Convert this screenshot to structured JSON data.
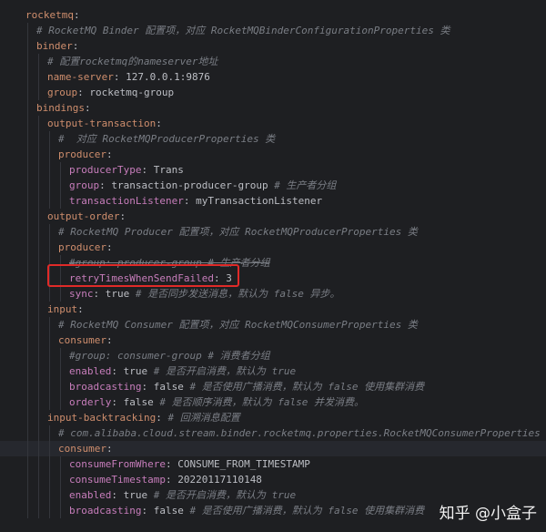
{
  "editor": {
    "highlight_line": 17,
    "current_line": 28,
    "lines": [
      {
        "indent": 0,
        "key": "rocketmq",
        "key_type": "root",
        "sep": ":",
        "value": "",
        "comment": ""
      },
      {
        "indent": 1,
        "key": "",
        "sep": "",
        "value": "",
        "comment": "# RocketMQ Binder 配置项，对应 RocketMQBinderConfigurationProperties 类"
      },
      {
        "indent": 1,
        "key": "binder",
        "key_type": "root",
        "sep": ":",
        "value": "",
        "comment": ""
      },
      {
        "indent": 2,
        "key": "",
        "sep": "",
        "value": "",
        "comment": "# 配置rocketmq的nameserver地址"
      },
      {
        "indent": 2,
        "key": "name-server",
        "key_type": "root",
        "sep": ": ",
        "value": "127.0.0.1:9876",
        "comment": ""
      },
      {
        "indent": 2,
        "key": "group",
        "key_type": "root",
        "sep": ": ",
        "value": "rocketmq-group",
        "comment": ""
      },
      {
        "indent": 1,
        "key": "bindings",
        "key_type": "root",
        "sep": ":",
        "value": "",
        "comment": ""
      },
      {
        "indent": 2,
        "key": "output-transaction",
        "key_type": "root",
        "sep": ":",
        "value": "",
        "comment": ""
      },
      {
        "indent": 3,
        "key": "",
        "sep": "",
        "value": "",
        "comment": "#  对应 RocketMQProducerProperties 类"
      },
      {
        "indent": 3,
        "key": "producer",
        "key_type": "root",
        "sep": ":",
        "value": "",
        "comment": ""
      },
      {
        "indent": 4,
        "key": "producerType",
        "key_type": "prop",
        "sep": ": ",
        "value": "Trans",
        "comment": ""
      },
      {
        "indent": 4,
        "key": "group",
        "key_type": "prop",
        "sep": ": ",
        "value": "transaction-producer-group ",
        "comment": "# 生产者分组"
      },
      {
        "indent": 4,
        "key": "transactionListener",
        "key_type": "prop",
        "sep": ": ",
        "value": "myTransactionListener",
        "comment": ""
      },
      {
        "indent": 2,
        "key": "output-order",
        "key_type": "root",
        "sep": ":",
        "value": "",
        "comment": ""
      },
      {
        "indent": 3,
        "key": "",
        "sep": "",
        "value": "",
        "comment": "# RocketMQ Producer 配置项，对应 RocketMQProducerProperties 类"
      },
      {
        "indent": 3,
        "key": "producer",
        "key_type": "root",
        "sep": ":",
        "value": "",
        "comment": ""
      },
      {
        "indent": 4,
        "key": "",
        "sep": "",
        "value": "",
        "comment": "#group: producer-group # 生产者分组",
        "strike": true
      },
      {
        "indent": 4,
        "key": "retryTimesWhenSendFailed",
        "key_type": "prop",
        "sep": ": ",
        "value": "3",
        "comment": ""
      },
      {
        "indent": 4,
        "key": "sync",
        "key_type": "prop",
        "sep": ": ",
        "value": "true ",
        "comment": "# 是否同步发送消息，默认为 false 异步。"
      },
      {
        "indent": 2,
        "key": "input",
        "key_type": "root",
        "sep": ":",
        "value": "",
        "comment": ""
      },
      {
        "indent": 3,
        "key": "",
        "sep": "",
        "value": "",
        "comment": "# RocketMQ Consumer 配置项，对应 RocketMQConsumerProperties 类"
      },
      {
        "indent": 3,
        "key": "consumer",
        "key_type": "root",
        "sep": ":",
        "value": "",
        "comment": ""
      },
      {
        "indent": 4,
        "key": "",
        "sep": "",
        "value": "",
        "comment": "#group: consumer-group # 消费者分组"
      },
      {
        "indent": 4,
        "key": "enabled",
        "key_type": "prop",
        "sep": ": ",
        "value": "true ",
        "comment": "# 是否开启消费，默认为 true"
      },
      {
        "indent": 4,
        "key": "broadcasting",
        "key_type": "prop",
        "sep": ": ",
        "value": "false ",
        "comment": "# 是否使用广播消费，默认为 false 使用集群消费"
      },
      {
        "indent": 4,
        "key": "orderly",
        "key_type": "prop",
        "sep": ": ",
        "value": "false ",
        "comment": "# 是否顺序消费，默认为 false 并发消费。"
      },
      {
        "indent": 2,
        "key": "input-backtracking",
        "key_type": "root",
        "sep": ":",
        "value": " ",
        "comment": "# 回溯消息配置"
      },
      {
        "indent": 3,
        "key": "",
        "sep": "",
        "value": "",
        "comment": "# com.alibaba.cloud.stream.binder.rocketmq.properties.RocketMQConsumerProperties"
      },
      {
        "indent": 3,
        "key": "consumer",
        "key_type": "root",
        "sep": ":",
        "value": "",
        "comment": ""
      },
      {
        "indent": 4,
        "key": "consumeFromWhere",
        "key_type": "prop",
        "sep": ": ",
        "value": "CONSUME_FROM_TIMESTAMP",
        "comment": ""
      },
      {
        "indent": 4,
        "key": "consumeTimestamp",
        "key_type": "prop",
        "sep": ": ",
        "value": "20220117110148",
        "comment": ""
      },
      {
        "indent": 4,
        "key": "enabled",
        "key_type": "prop",
        "sep": ": ",
        "value": "true ",
        "comment": "# 是否开启消费，默认为 true"
      },
      {
        "indent": 4,
        "key": "broadcasting",
        "key_type": "prop",
        "sep": ": ",
        "value": "false ",
        "comment": "# 是否使用广播消费，默认为 false 使用集群消费"
      }
    ]
  },
  "watermark": "知乎 @小盒子",
  "colors": {
    "background": "#1e1f22",
    "key_root": "#cf8e6d",
    "key_prop": "#c77dbb",
    "value": "#bcbec4",
    "comment": "#7a7e85",
    "highlight_box": "#e02a28"
  }
}
